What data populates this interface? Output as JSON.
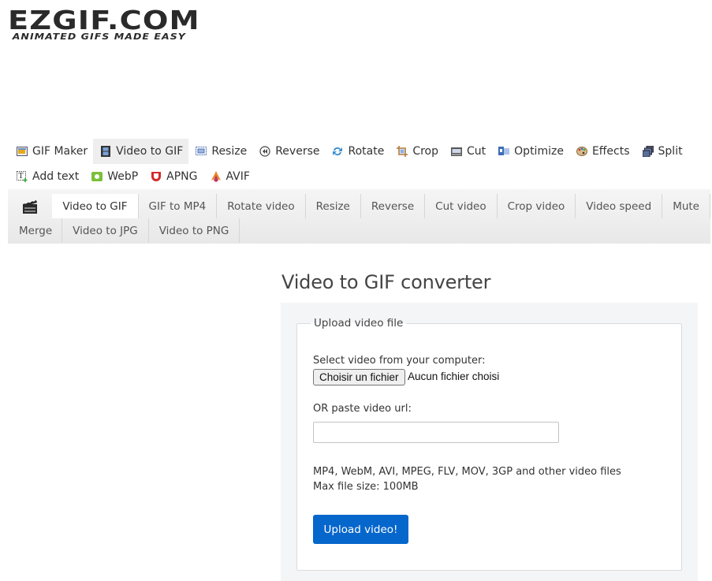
{
  "logo": {
    "name": "EZGIF.COM",
    "tagline": "ANIMATED GIFS MADE EASY"
  },
  "main_nav": {
    "row1": [
      {
        "label": "GIF Maker",
        "icon": "gif-maker-icon",
        "active": false
      },
      {
        "label": "Video to GIF",
        "icon": "film-icon",
        "active": true
      },
      {
        "label": "Resize",
        "icon": "resize-icon",
        "active": false
      },
      {
        "label": "Reverse",
        "icon": "reverse-icon",
        "active": false
      },
      {
        "label": "Rotate",
        "icon": "rotate-icon",
        "active": false
      },
      {
        "label": "Crop",
        "icon": "crop-icon",
        "active": false
      },
      {
        "label": "Cut",
        "icon": "cut-icon",
        "active": false
      },
      {
        "label": "Optimize",
        "icon": "optimize-icon",
        "active": false
      },
      {
        "label": "Effects",
        "icon": "palette-icon",
        "active": false
      },
      {
        "label": "Split",
        "icon": "split-icon",
        "active": false
      }
    ],
    "row2": [
      {
        "label": "Add text",
        "icon": "add-text-icon",
        "active": false
      },
      {
        "label": "WebP",
        "icon": "webp-icon",
        "active": false
      },
      {
        "label": "APNG",
        "icon": "apng-icon",
        "active": false
      },
      {
        "label": "AVIF",
        "icon": "avif-icon",
        "active": false
      }
    ]
  },
  "sub_nav": {
    "icon": "clapperboard-icon",
    "row1": [
      "Video to GIF",
      "GIF to MP4",
      "Rotate video",
      "Resize",
      "Reverse",
      "Cut video",
      "Crop video",
      "Video speed",
      "Mute"
    ],
    "row2": [
      "Merge",
      "Video to JPG",
      "Video to PNG"
    ],
    "active": "Video to GIF"
  },
  "page": {
    "title": "Video to GIF converter",
    "form": {
      "legend": "Upload video file",
      "select_label": "Select video from your computer:",
      "file_button": "Choisir un fichier",
      "file_status": "Aucun fichier choisi",
      "url_label": "OR paste video url:",
      "url_value": "",
      "url_placeholder": "",
      "formats": "MP4, WebM, AVI, MPEG, FLV, MOV, 3GP and other video files",
      "max_size": "Max file size: 100MB",
      "submit": "Upload video!"
    }
  },
  "colors": {
    "accent": "#0566cc",
    "panel_bg": "#f4f5f7",
    "active_tab": "#eeeeee"
  }
}
